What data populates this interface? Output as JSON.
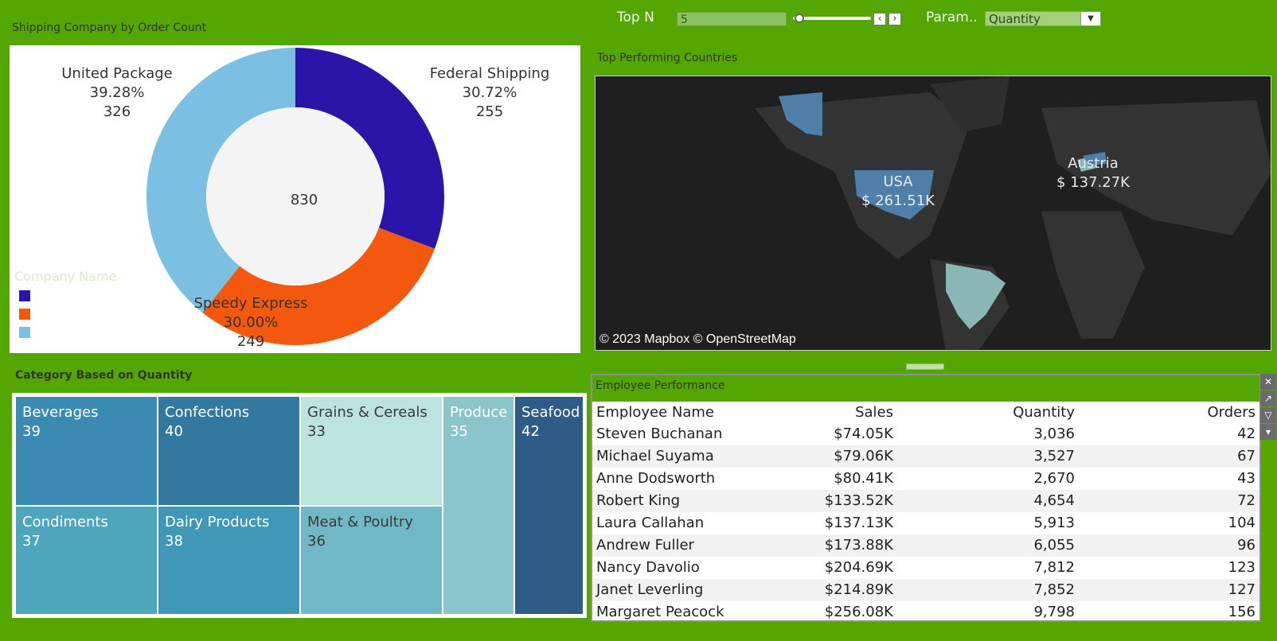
{
  "controls": {
    "topn_label": "Top N",
    "topn_value": "5",
    "param_label": "Param..",
    "param_value": "Quantity"
  },
  "shipping": {
    "title": "Shipping Company by Order Count",
    "total": "830",
    "segments": [
      {
        "name": "Federal Shipping",
        "pct": "30.72%",
        "count": "255",
        "value": 255,
        "color": "#2b14a8"
      },
      {
        "name": "Speedy Express",
        "pct": "30.00%",
        "count": "249",
        "value": 249,
        "color": "#f4580e"
      },
      {
        "name": "United Package",
        "pct": "39.28%",
        "count": "326",
        "value": 326,
        "color": "#7bbfe3"
      }
    ],
    "legend_title": "Company Name"
  },
  "map": {
    "title": "Top Performing Countries",
    "countries": [
      {
        "name": "USA",
        "value": "$ 261.51K"
      },
      {
        "name": "Austria",
        "value": "$ 137.27K"
      }
    ],
    "attribution": "© 2023 Mapbox © OpenStreetMap"
  },
  "category": {
    "title": "Category Based on Quantity",
    "cells": [
      {
        "name": "Beverages",
        "value": "39",
        "color": "#3a8ab2"
      },
      {
        "name": "Confections",
        "value": "40",
        "color": "#33789f"
      },
      {
        "name": "Grains & Cereals",
        "value": "33",
        "color": "#bde4da",
        "dark": true
      },
      {
        "name": "Produce",
        "value": "35",
        "color": "#8bc5cc"
      },
      {
        "name": "Seafood",
        "value": "42",
        "color": "#2e5c87"
      },
      {
        "name": "Condiments",
        "value": "37",
        "color": "#4ea6bd"
      },
      {
        "name": "Dairy Products",
        "value": "38",
        "color": "#3f98b7"
      },
      {
        "name": "Meat & Poultry",
        "value": "36",
        "color": "#70b8c5",
        "dark": true
      }
    ]
  },
  "employees": {
    "title": "Employee Performance",
    "headers": [
      "Employee Name",
      "Sales",
      "Quantity",
      "Orders"
    ],
    "rows": [
      [
        "Steven Buchanan",
        "$74.05K",
        "3,036",
        "42"
      ],
      [
        "Michael Suyama",
        "$79.06K",
        "3,527",
        "67"
      ],
      [
        "Anne Dodsworth",
        "$80.41K",
        "2,670",
        "43"
      ],
      [
        "Robert King",
        "$133.52K",
        "4,654",
        "72"
      ],
      [
        "Laura Callahan",
        "$137.13K",
        "5,913",
        "104"
      ],
      [
        "Andrew Fuller",
        "$173.88K",
        "6,055",
        "96"
      ],
      [
        "Nancy Davolio",
        "$204.69K",
        "7,812",
        "123"
      ],
      [
        "Janet Leverling",
        "$214.89K",
        "7,852",
        "127"
      ],
      [
        "Margaret Peacock",
        "$256.08K",
        "9,798",
        "156"
      ]
    ]
  }
}
